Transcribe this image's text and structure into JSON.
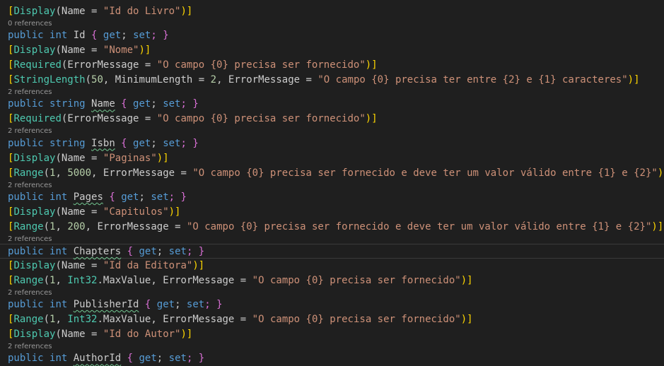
{
  "lines": [
    {
      "kind": "code",
      "tokens": [
        [
          "[",
          "bracket"
        ],
        [
          "Display",
          "attr"
        ],
        [
          "(",
          "id"
        ],
        [
          "Name",
          "id"
        ],
        [
          " = ",
          "id"
        ],
        [
          "\"Id do Livro\"",
          "str"
        ],
        [
          ")]",
          "bracket"
        ]
      ]
    },
    {
      "kind": "lens",
      "text": "0 references"
    },
    {
      "kind": "code",
      "tokens": [
        [
          "public",
          "kw"
        ],
        [
          " ",
          "id"
        ],
        [
          "int",
          "kw"
        ],
        [
          " ",
          "id"
        ],
        [
          "Id",
          "id"
        ],
        [
          " { ",
          "brace"
        ],
        [
          "get",
          "kw"
        ],
        [
          "; ",
          "id"
        ],
        [
          "set",
          "kw"
        ],
        [
          "; }",
          "brace"
        ]
      ]
    },
    {
      "kind": "code",
      "tokens": [
        [
          "[",
          "bracket"
        ],
        [
          "Display",
          "attr"
        ],
        [
          "(",
          "id"
        ],
        [
          "Name",
          "id"
        ],
        [
          " = ",
          "id"
        ],
        [
          "\"Nome\"",
          "str"
        ],
        [
          ")]",
          "bracket"
        ]
      ]
    },
    {
      "kind": "code",
      "tokens": [
        [
          "[",
          "bracket"
        ],
        [
          "Required",
          "attr"
        ],
        [
          "(",
          "id"
        ],
        [
          "ErrorMessage",
          "id"
        ],
        [
          " = ",
          "id"
        ],
        [
          "\"O campo {0} precisa ser fornecido\"",
          "str"
        ],
        [
          ")]",
          "bracket"
        ]
      ]
    },
    {
      "kind": "code",
      "tokens": [
        [
          "[",
          "bracket"
        ],
        [
          "StringLength",
          "attr"
        ],
        [
          "(",
          "id"
        ],
        [
          "50",
          "num"
        ],
        [
          ", ",
          "id"
        ],
        [
          "MinimumLength",
          "id"
        ],
        [
          " = ",
          "id"
        ],
        [
          "2",
          "num"
        ],
        [
          ", ",
          "id"
        ],
        [
          "ErrorMessage",
          "id"
        ],
        [
          " = ",
          "id"
        ],
        [
          "\"O campo {0} precisa ter entre {2} e {1} caracteres\"",
          "str"
        ],
        [
          ")]",
          "bracket"
        ]
      ]
    },
    {
      "kind": "lens",
      "text": "2 references"
    },
    {
      "kind": "code",
      "tokens": [
        [
          "public",
          "kw"
        ],
        [
          " ",
          "id"
        ],
        [
          "string",
          "kw"
        ],
        [
          " ",
          "id"
        ],
        [
          "Name",
          "squig"
        ],
        [
          " { ",
          "brace"
        ],
        [
          "get",
          "kw"
        ],
        [
          "; ",
          "id"
        ],
        [
          "set",
          "kw"
        ],
        [
          "; }",
          "brace"
        ]
      ]
    },
    {
      "kind": "code",
      "tokens": [
        [
          "[",
          "bracket"
        ],
        [
          "Required",
          "attr"
        ],
        [
          "(",
          "id"
        ],
        [
          "ErrorMessage",
          "id"
        ],
        [
          " = ",
          "id"
        ],
        [
          "\"O campo {0} precisa ser fornecido\"",
          "str"
        ],
        [
          ")]",
          "bracket"
        ]
      ]
    },
    {
      "kind": "lens",
      "text": "2 references"
    },
    {
      "kind": "code",
      "tokens": [
        [
          "public",
          "kw"
        ],
        [
          " ",
          "id"
        ],
        [
          "string",
          "kw"
        ],
        [
          " ",
          "id"
        ],
        [
          "Isbn",
          "squig"
        ],
        [
          " { ",
          "brace"
        ],
        [
          "get",
          "kw"
        ],
        [
          "; ",
          "id"
        ],
        [
          "set",
          "kw"
        ],
        [
          "; }",
          "brace"
        ]
      ]
    },
    {
      "kind": "code",
      "tokens": [
        [
          "[",
          "bracket"
        ],
        [
          "Display",
          "attr"
        ],
        [
          "(",
          "id"
        ],
        [
          "Name",
          "id"
        ],
        [
          " = ",
          "id"
        ],
        [
          "\"Paginas\"",
          "str"
        ],
        [
          ")]",
          "bracket"
        ]
      ]
    },
    {
      "kind": "code",
      "tokens": [
        [
          "[",
          "bracket"
        ],
        [
          "Range",
          "attr"
        ],
        [
          "(",
          "id"
        ],
        [
          "1",
          "num"
        ],
        [
          ", ",
          "id"
        ],
        [
          "5000",
          "num"
        ],
        [
          ", ",
          "id"
        ],
        [
          "ErrorMessage",
          "id"
        ],
        [
          " = ",
          "id"
        ],
        [
          "\"O campo {0} precisa ser fornecido e deve ter um valor válido entre {1} e {2}\"",
          "str"
        ],
        [
          ")]",
          "bracket"
        ]
      ]
    },
    {
      "kind": "lens",
      "text": "2 references"
    },
    {
      "kind": "code",
      "tokens": [
        [
          "public",
          "kw"
        ],
        [
          " ",
          "id"
        ],
        [
          "int",
          "kw"
        ],
        [
          " ",
          "id"
        ],
        [
          "Pages",
          "squig"
        ],
        [
          " { ",
          "brace"
        ],
        [
          "get",
          "kw"
        ],
        [
          "; ",
          "id"
        ],
        [
          "set",
          "kw"
        ],
        [
          "; }",
          "brace"
        ]
      ]
    },
    {
      "kind": "code",
      "tokens": [
        [
          "[",
          "bracket"
        ],
        [
          "Display",
          "attr"
        ],
        [
          "(",
          "id"
        ],
        [
          "Name",
          "id"
        ],
        [
          " = ",
          "id"
        ],
        [
          "\"Capitulos\"",
          "str"
        ],
        [
          ")]",
          "bracket"
        ]
      ]
    },
    {
      "kind": "code",
      "tokens": [
        [
          "[",
          "bracket"
        ],
        [
          "Range",
          "attr"
        ],
        [
          "(",
          "id"
        ],
        [
          "1",
          "num"
        ],
        [
          ", ",
          "id"
        ],
        [
          "200",
          "num"
        ],
        [
          ", ",
          "id"
        ],
        [
          "ErrorMessage",
          "id"
        ],
        [
          " = ",
          "id"
        ],
        [
          "\"O campo {0} precisa ser fornecido e deve ter um valor válido entre {1} e {2}\"",
          "str"
        ],
        [
          ")]",
          "bracket"
        ]
      ]
    },
    {
      "kind": "lens",
      "text": "2 references"
    },
    {
      "kind": "code",
      "current": true,
      "tokens": [
        [
          "public",
          "kw"
        ],
        [
          " ",
          "id"
        ],
        [
          "int",
          "kw"
        ],
        [
          " ",
          "id"
        ],
        [
          "Chapters",
          "squig"
        ],
        [
          " { ",
          "brace"
        ],
        [
          "get",
          "kw"
        ],
        [
          "; ",
          "id"
        ],
        [
          "set",
          "kw"
        ],
        [
          "; }",
          "brace"
        ]
      ]
    },
    {
      "kind": "code",
      "tokens": [
        [
          "[",
          "bracket"
        ],
        [
          "Display",
          "attr"
        ],
        [
          "(",
          "id"
        ],
        [
          "Name",
          "id"
        ],
        [
          " = ",
          "id"
        ],
        [
          "\"Id da Editora\"",
          "str"
        ],
        [
          ")]",
          "bracket"
        ]
      ]
    },
    {
      "kind": "code",
      "tokens": [
        [
          "[",
          "bracket"
        ],
        [
          "Range",
          "attr"
        ],
        [
          "(",
          "id"
        ],
        [
          "1",
          "num"
        ],
        [
          ", ",
          "id"
        ],
        [
          "Int32",
          "type"
        ],
        [
          ".",
          "id"
        ],
        [
          "MaxValue",
          "id"
        ],
        [
          ", ",
          "id"
        ],
        [
          "ErrorMessage",
          "id"
        ],
        [
          " = ",
          "id"
        ],
        [
          "\"O campo {0} precisa ser fornecido\"",
          "str"
        ],
        [
          ")]",
          "bracket"
        ]
      ]
    },
    {
      "kind": "lens",
      "text": "2 references"
    },
    {
      "kind": "code",
      "tokens": [
        [
          "public",
          "kw"
        ],
        [
          " ",
          "id"
        ],
        [
          "int",
          "kw"
        ],
        [
          " ",
          "id"
        ],
        [
          "PublisherId",
          "squig"
        ],
        [
          " { ",
          "brace"
        ],
        [
          "get",
          "kw"
        ],
        [
          "; ",
          "id"
        ],
        [
          "set",
          "kw"
        ],
        [
          "; }",
          "brace"
        ]
      ]
    },
    {
      "kind": "code",
      "tokens": [
        [
          "[",
          "bracket"
        ],
        [
          "Range",
          "attr"
        ],
        [
          "(",
          "id"
        ],
        [
          "1",
          "num"
        ],
        [
          ", ",
          "id"
        ],
        [
          "Int32",
          "type"
        ],
        [
          ".",
          "id"
        ],
        [
          "MaxValue",
          "id"
        ],
        [
          ", ",
          "id"
        ],
        [
          "ErrorMessage",
          "id"
        ],
        [
          " = ",
          "id"
        ],
        [
          "\"O campo {0} precisa ser fornecido\"",
          "str"
        ],
        [
          ")]",
          "bracket"
        ]
      ]
    },
    {
      "kind": "code",
      "tokens": [
        [
          "[",
          "bracket"
        ],
        [
          "Display",
          "attr"
        ],
        [
          "(",
          "id"
        ],
        [
          "Name",
          "id"
        ],
        [
          " = ",
          "id"
        ],
        [
          "\"Id do Autor\"",
          "str"
        ],
        [
          ")]",
          "bracket"
        ]
      ]
    },
    {
      "kind": "lens",
      "text": "2 references"
    },
    {
      "kind": "code",
      "tokens": [
        [
          "public",
          "kw"
        ],
        [
          " ",
          "id"
        ],
        [
          "int",
          "kw"
        ],
        [
          " ",
          "id"
        ],
        [
          "AuthorId",
          "squig"
        ],
        [
          " { ",
          "brace"
        ],
        [
          "get",
          "kw"
        ],
        [
          "; ",
          "id"
        ],
        [
          "set",
          "kw"
        ],
        [
          "; }",
          "brace"
        ]
      ]
    }
  ],
  "colors": {
    "background": "#1f1f1f",
    "keyword": "#569cd6",
    "attribute": "#4ec9b0",
    "string": "#ce9178",
    "number": "#b5cea8",
    "bracket": "#ffd700",
    "brace": "#da70d6",
    "codelens": "#999999"
  }
}
